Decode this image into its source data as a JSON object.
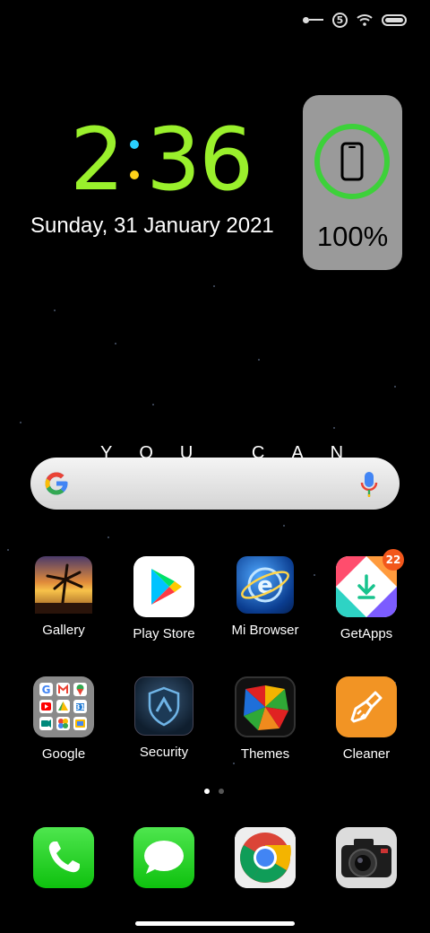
{
  "status_bar": {
    "notification_count": "5",
    "icons": [
      "key-icon",
      "wifi-icon",
      "battery-icon"
    ]
  },
  "clock": {
    "hours": "2",
    "minutes": "36",
    "date": "Sunday, 31 January 2021",
    "colors": {
      "digits": "#9af02c",
      "colon_top": "#2ad0ff",
      "colon_bottom": "#ffd21a"
    }
  },
  "battery_widget": {
    "percent": "100%",
    "level": 1.0,
    "ring_color": "#3dd13a"
  },
  "wallpaper_text": "YOU CAN",
  "search": {
    "icons": [
      "google-logo-icon",
      "mic-icon"
    ]
  },
  "apps": [
    {
      "label": "Gallery",
      "icon": "gallery-icon"
    },
    {
      "label": "Play Store",
      "icon": "play-store-icon"
    },
    {
      "label": "Mi Browser",
      "icon": "mi-browser-icon"
    },
    {
      "label": "GetApps",
      "icon": "getapps-icon",
      "badge": "22"
    },
    {
      "label": "Google",
      "icon": "google-folder-icon"
    },
    {
      "label": "Security",
      "icon": "security-icon"
    },
    {
      "label": "Themes",
      "icon": "themes-icon"
    },
    {
      "label": "Cleaner",
      "icon": "cleaner-icon"
    }
  ],
  "pager": {
    "pages": 2,
    "current": 1
  },
  "dock": [
    {
      "icon": "phone-icon"
    },
    {
      "icon": "messages-icon"
    },
    {
      "icon": "chrome-icon"
    },
    {
      "icon": "camera-icon"
    }
  ]
}
